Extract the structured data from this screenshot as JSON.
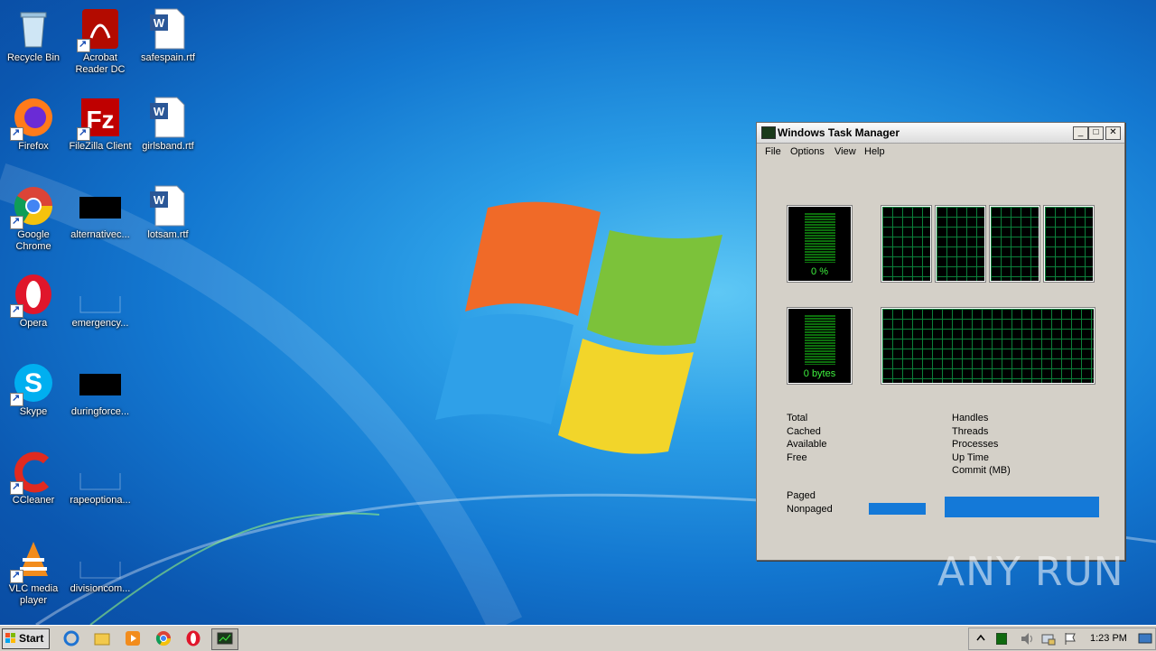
{
  "desktop": {
    "icons": [
      {
        "label": "Recycle Bin",
        "icon": "recycle-bin-icon"
      },
      {
        "label": "Acrobat Reader DC",
        "icon": "acrobat-icon"
      },
      {
        "label": "safespain.rtf",
        "icon": "word-doc-icon"
      },
      {
        "label": "Firefox",
        "icon": "firefox-icon"
      },
      {
        "label": "FileZilla Client",
        "icon": "filezilla-icon"
      },
      {
        "label": "girlsband.rtf",
        "icon": "word-doc-icon"
      },
      {
        "label": "Google Chrome",
        "icon": "chrome-icon"
      },
      {
        "label": "alternativec...",
        "icon": "black-file-icon"
      },
      {
        "label": "lotsam.rtf",
        "icon": "word-doc-icon"
      },
      {
        "label": "Opera",
        "icon": "opera-icon"
      },
      {
        "label": "emergency...",
        "icon": "blank-file-icon"
      },
      {
        "label": "Skype",
        "icon": "skype-icon"
      },
      {
        "label": "duringforce...",
        "icon": "black-file-icon"
      },
      {
        "label": "CCleaner",
        "icon": "ccleaner-icon"
      },
      {
        "label": "rapeoptiona...",
        "icon": "blank-file-icon"
      },
      {
        "label": "VLC media player",
        "icon": "vlc-icon"
      },
      {
        "label": "divisioncom...",
        "icon": "blank-file-icon"
      }
    ]
  },
  "task_manager": {
    "title": "Windows Task Manager",
    "window_buttons": {
      "minimize": "_",
      "maximize": "□",
      "close": "✕"
    },
    "menu": [
      "File",
      "Options",
      "View",
      "Help"
    ],
    "cpu_usage_label": "0 %",
    "pf_usage_label": "0 bytes",
    "physical_memory_stats": [
      "Total",
      "Cached",
      "Available",
      "Free"
    ],
    "system_stats": [
      "Handles",
      "Threads",
      "Processes",
      "Up Time",
      "Commit (MB)"
    ],
    "kernel_memory_stats": [
      "Paged",
      "Nonpaged"
    ]
  },
  "taskbar": {
    "start_label": "Start",
    "pinned": [
      "internet-explorer-icon",
      "explorer-icon",
      "media-player-icon",
      "chrome-icon",
      "opera-icon",
      "task-manager-icon"
    ],
    "clock": "1:23 PM"
  },
  "watermark": "ANY RUN",
  "colors": {
    "accent": "#1479d8",
    "graph_green": "#3ef03e"
  }
}
